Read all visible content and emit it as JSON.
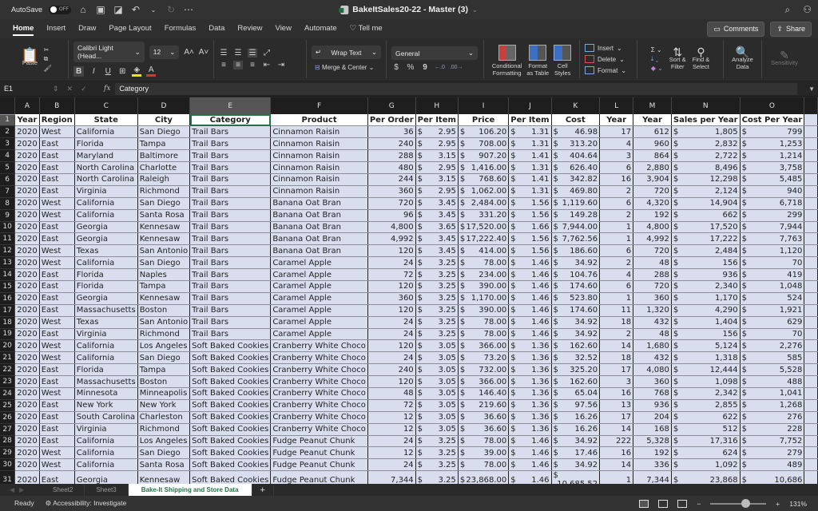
{
  "titlebar": {
    "autosave_label": "AutoSave",
    "autosave_state": "OFF",
    "title": "BakeItSales20-22 - Master (3)",
    "icons": [
      "home-icon",
      "save-icon",
      "save-as-icon",
      "undo-icon",
      "redo-icon",
      "more-icon",
      "search-icon",
      "share-people-icon"
    ]
  },
  "menu": {
    "items": [
      "Home",
      "Insert",
      "Draw",
      "Page Layout",
      "Formulas",
      "Data",
      "Review",
      "View",
      "Automate"
    ],
    "active": "Home",
    "tell_me": "Tell me",
    "comments_label": "Comments",
    "share_label": "Share"
  },
  "ribbon": {
    "paste_label": "Paste",
    "font_name": "Calibri Light (Head...",
    "font_size": "12",
    "wrap_text": "Wrap Text",
    "merge_center": "Merge & Center",
    "number_format": "General",
    "currency_symbol": "$",
    "percent_symbol": "%",
    "comma_symbol": "9",
    "conditional_formatting": [
      "Conditional",
      "Formatting"
    ],
    "format_as_table": [
      "Format",
      "as Table"
    ],
    "cell_styles": [
      "Cell",
      "Styles"
    ],
    "insert": "Insert",
    "delete": "Delete",
    "format": "Format",
    "sort_filter": [
      "Sort &",
      "Filter"
    ],
    "find_select": [
      "Find &",
      "Select"
    ],
    "analyze_data": [
      "Analyze",
      "Data"
    ],
    "sensitivity": "Sensitivity",
    "colors": {
      "highlight": "#f5e600",
      "font_color": "#e03030"
    }
  },
  "formula_bar": {
    "name_box": "E1",
    "fx": "fx",
    "content": "Category"
  },
  "sheet": {
    "columns": [
      "A",
      "B",
      "C",
      "D",
      "E",
      "F",
      "G",
      "H",
      "I",
      "J",
      "K",
      "L",
      "M",
      "N",
      "O"
    ],
    "selected_column": "E",
    "selected_cell": "E1",
    "headers": [
      "Year",
      "Region",
      "State",
      "City",
      "Category",
      "Product",
      "Per Order",
      "Per Item",
      "Price",
      "Per Item",
      "Cost",
      "Year",
      "Year",
      "Sales per Year",
      "Cost Per Year"
    ],
    "rows": [
      [
        "2020",
        "West",
        "California",
        "San Diego",
        "Trail Bars",
        "Cinnamon Raisin",
        "36",
        "2.95",
        "106.20",
        "1.31",
        "46.98",
        "17",
        "612",
        "1,805",
        "799"
      ],
      [
        "2020",
        "East",
        "Florida",
        "Tampa",
        "Trail Bars",
        "Cinnamon Raisin",
        "240",
        "2.95",
        "708.00",
        "1.31",
        "313.20",
        "4",
        "960",
        "2,832",
        "1,253"
      ],
      [
        "2020",
        "East",
        "Maryland",
        "Baltimore",
        "Trail Bars",
        "Cinnamon Raisin",
        "288",
        "3.15",
        "907.20",
        "1.41",
        "404.64",
        "3",
        "864",
        "2,722",
        "1,214"
      ],
      [
        "2020",
        "East",
        "North Carolina",
        "Charlotte",
        "Trail Bars",
        "Cinnamon Raisin",
        "480",
        "2.95",
        "1,416.00",
        "1.31",
        "626.40",
        "6",
        "2,880",
        "8,496",
        "3,758"
      ],
      [
        "2020",
        "East",
        "North Carolina",
        "Raleigh",
        "Trail Bars",
        "Cinnamon Raisin",
        "244",
        "3.15",
        "768.60",
        "1.41",
        "342.82",
        "16",
        "3,904",
        "12,298",
        "5,485"
      ],
      [
        "2020",
        "East",
        "Virginia",
        "Richmond",
        "Trail Bars",
        "Cinnamon Raisin",
        "360",
        "2.95",
        "1,062.00",
        "1.31",
        "469.80",
        "2",
        "720",
        "2,124",
        "940"
      ],
      [
        "2020",
        "West",
        "California",
        "San Diego",
        "Trail Bars",
        "Banana Oat Bran",
        "720",
        "3.45",
        "2,484.00",
        "1.56",
        "1,119.60",
        "6",
        "4,320",
        "14,904",
        "6,718"
      ],
      [
        "2020",
        "West",
        "California",
        "Santa Rosa",
        "Trail Bars",
        "Banana Oat Bran",
        "96",
        "3.45",
        "331.20",
        "1.56",
        "149.28",
        "2",
        "192",
        "662",
        "299"
      ],
      [
        "2020",
        "East",
        "Georgia",
        "Kennesaw",
        "Trail Bars",
        "Banana Oat Bran",
        "4,800",
        "3.65",
        "17,520.00",
        "1.66",
        "7,944.00",
        "1",
        "4,800",
        "17,520",
        "7,944"
      ],
      [
        "2020",
        "East",
        "Georgia",
        "Kennesaw",
        "Trail Bars",
        "Banana Oat Bran",
        "4,992",
        "3.45",
        "17,222.40",
        "1.56",
        "7,762.56",
        "1",
        "4,992",
        "17,222",
        "7,763"
      ],
      [
        "2020",
        "West",
        "Texas",
        "San Antonio",
        "Trail Bars",
        "Banana Oat Bran",
        "120",
        "3.45",
        "414.00",
        "1.56",
        "186.60",
        "6",
        "720",
        "2,484",
        "1,120"
      ],
      [
        "2020",
        "West",
        "California",
        "San Diego",
        "Trail Bars",
        "Caramel Apple",
        "24",
        "3.25",
        "78.00",
        "1.46",
        "34.92",
        "2",
        "48",
        "156",
        "70"
      ],
      [
        "2020",
        "East",
        "Florida",
        "Naples",
        "Trail Bars",
        "Caramel Apple",
        "72",
        "3.25",
        "234.00",
        "1.46",
        "104.76",
        "4",
        "288",
        "936",
        "419"
      ],
      [
        "2020",
        "East",
        "Florida",
        "Tampa",
        "Trail Bars",
        "Caramel Apple",
        "120",
        "3.25",
        "390.00",
        "1.46",
        "174.60",
        "6",
        "720",
        "2,340",
        "1,048"
      ],
      [
        "2020",
        "East",
        "Georgia",
        "Kennesaw",
        "Trail Bars",
        "Caramel Apple",
        "360",
        "3.25",
        "1,170.00",
        "1.46",
        "523.80",
        "1",
        "360",
        "1,170",
        "524"
      ],
      [
        "2020",
        "East",
        "Massachusetts",
        "Boston",
        "Trail Bars",
        "Caramel Apple",
        "120",
        "3.25",
        "390.00",
        "1.46",
        "174.60",
        "11",
        "1,320",
        "4,290",
        "1,921"
      ],
      [
        "2020",
        "West",
        "Texas",
        "San Antonio",
        "Trail Bars",
        "Caramel Apple",
        "24",
        "3.25",
        "78.00",
        "1.46",
        "34.92",
        "18",
        "432",
        "1,404",
        "629"
      ],
      [
        "2020",
        "East",
        "Virginia",
        "Richmond",
        "Trail Bars",
        "Caramel Apple",
        "24",
        "3.25",
        "78.00",
        "1.46",
        "34.92",
        "2",
        "48",
        "156",
        "70"
      ],
      [
        "2020",
        "West",
        "California",
        "Los Angeles",
        "Soft Baked Cookies",
        "Cranberry White Choco",
        "120",
        "3.05",
        "366.00",
        "1.36",
        "162.60",
        "14",
        "1,680",
        "5,124",
        "2,276"
      ],
      [
        "2020",
        "West",
        "California",
        "San Diego",
        "Soft Baked Cookies",
        "Cranberry White Choco",
        "24",
        "3.05",
        "73.20",
        "1.36",
        "32.52",
        "18",
        "432",
        "1,318",
        "585"
      ],
      [
        "2020",
        "East",
        "Florida",
        "Tampa",
        "Soft Baked Cookies",
        "Cranberry White Choco",
        "240",
        "3.05",
        "732.00",
        "1.36",
        "325.20",
        "17",
        "4,080",
        "12,444",
        "5,528"
      ],
      [
        "2020",
        "East",
        "Massachusetts",
        "Boston",
        "Soft Baked Cookies",
        "Cranberry White Choco",
        "120",
        "3.05",
        "366.00",
        "1.36",
        "162.60",
        "3",
        "360",
        "1,098",
        "488"
      ],
      [
        "2020",
        "West",
        "Minnesota",
        "Minneapolis",
        "Soft Baked Cookies",
        "Cranberry White Choco",
        "48",
        "3.05",
        "146.40",
        "1.36",
        "65.04",
        "16",
        "768",
        "2,342",
        "1,041"
      ],
      [
        "2020",
        "East",
        "New York",
        "New York",
        "Soft Baked Cookies",
        "Cranberry White Choco",
        "72",
        "3.05",
        "219.60",
        "1.36",
        "97.56",
        "13",
        "936",
        "2,855",
        "1,268"
      ],
      [
        "2020",
        "East",
        "South Carolina",
        "Charleston",
        "Soft Baked Cookies",
        "Cranberry White Choco",
        "12",
        "3.05",
        "36.60",
        "1.36",
        "16.26",
        "17",
        "204",
        "622",
        "276"
      ],
      [
        "2020",
        "East",
        "Virginia",
        "Richmond",
        "Soft Baked Cookies",
        "Cranberry White Choco",
        "12",
        "3.05",
        "36.60",
        "1.36",
        "16.26",
        "14",
        "168",
        "512",
        "228"
      ],
      [
        "2020",
        "East",
        "California",
        "Los Angeles",
        "Soft Baked Cookies",
        "Fudge Peanut Chunk",
        "24",
        "3.25",
        "78.00",
        "1.46",
        "34.92",
        "222",
        "5,328",
        "17,316",
        "7,752"
      ],
      [
        "2020",
        "West",
        "California",
        "San Diego",
        "Soft Baked Cookies",
        "Fudge Peanut Chunk",
        "12",
        "3.25",
        "39.00",
        "1.46",
        "17.46",
        "16",
        "192",
        "624",
        "279"
      ],
      [
        "2020",
        "West",
        "California",
        "Santa Rosa",
        "Soft Baked Cookies",
        "Fudge Peanut Chunk",
        "24",
        "3.25",
        "78.00",
        "1.46",
        "34.92",
        "14",
        "336",
        "1,092",
        "489"
      ],
      [
        "2020",
        "East",
        "Georgia",
        "Kennesaw",
        "Soft Baked Cookies",
        "Fudge Peanut Chunk",
        "7,344",
        "3.25",
        "23,868.00",
        "1.46",
        "10,685.52",
        "1",
        "7,344",
        "23,868",
        "10,686"
      ]
    ]
  },
  "sheet_tabs": {
    "tabs": [
      "Sheet2",
      "Sheet3",
      "Bake-It Shipping and Store Data"
    ],
    "active": "Bake-It Shipping and Store Data",
    "add_label": "+"
  },
  "status": {
    "ready": "Ready",
    "accessibility": "Accessibility: Investigate",
    "zoom": "131%",
    "zoom_fraction": 0.55
  }
}
